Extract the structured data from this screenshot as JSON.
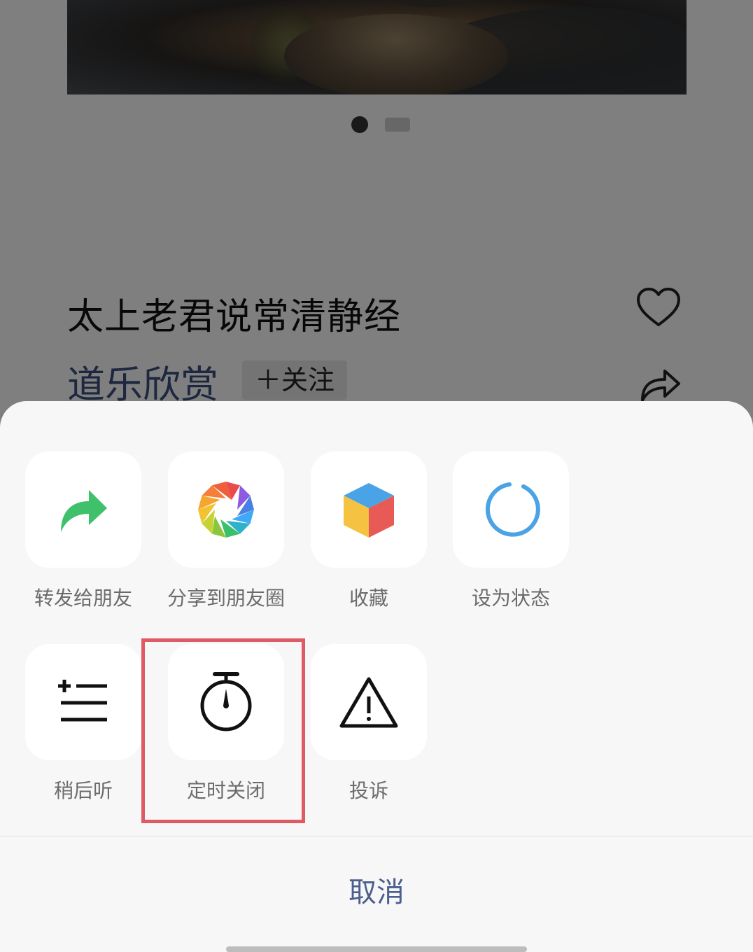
{
  "track": {
    "title": "太上老君说常清静经"
  },
  "channel": {
    "name": "道乐欣赏",
    "follow_label": "＋关注"
  },
  "carousel": {
    "active_index": 1,
    "count": 2
  },
  "actions_row1": [
    {
      "label": "转发给朋友",
      "icon": "forward-arrow-icon"
    },
    {
      "label": "分享到朋友圈",
      "icon": "moments-aperture-icon"
    },
    {
      "label": "收藏",
      "icon": "favorites-cube-icon"
    },
    {
      "label": "设为状态",
      "icon": "status-circle-icon"
    }
  ],
  "actions_row2": [
    {
      "label": "稍后听",
      "icon": "listen-later-list-icon"
    },
    {
      "label": "定时关闭",
      "icon": "timer-stopwatch-icon",
      "highlighted": true
    },
    {
      "label": "投诉",
      "icon": "warning-triangle-icon"
    }
  ],
  "cancel_label": "取消",
  "colors": {
    "highlight": "#de5a65",
    "accent_text": "#4b5e8e",
    "forward_green": "#3fc06b",
    "status_blue": "#4aa3e6"
  }
}
